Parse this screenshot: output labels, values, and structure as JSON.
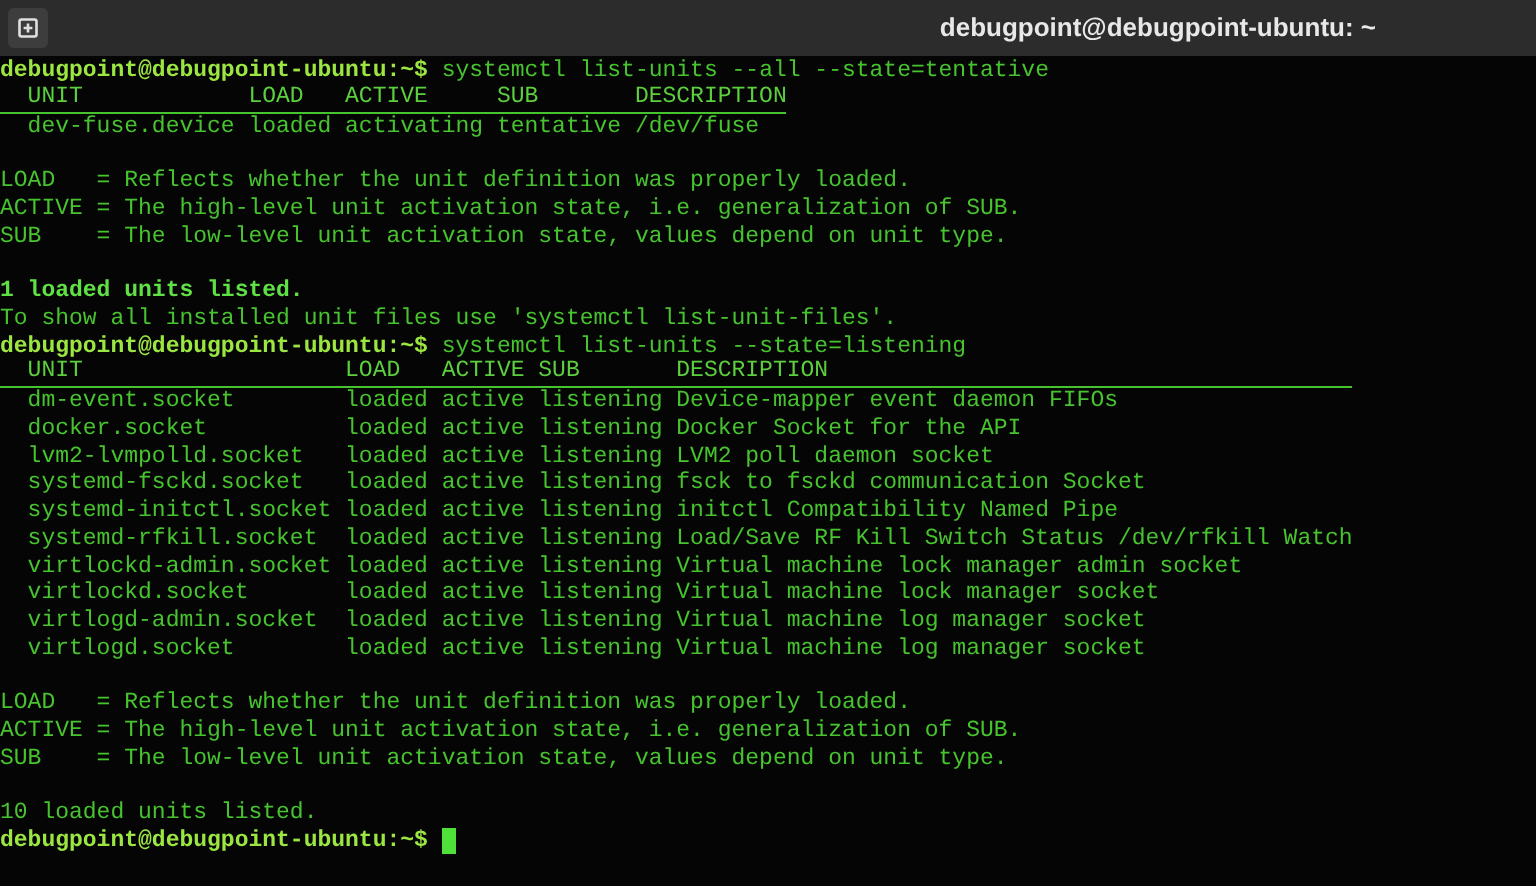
{
  "window": {
    "title": "debugpoint@debugpoint-ubuntu: ~"
  },
  "terminal": [
    {
      "kind": "prompt",
      "prompt": "debugpoint@debugpoint-ubuntu:~$",
      "command": "systemctl list-units --all --state=tentative",
      "cursor": false
    },
    {
      "kind": "table",
      "header": "  UNIT            LOAD   ACTIVE     SUB       DESCRIPTION",
      "rows": [
        "  dev-fuse.device loaded activating tentative /dev/fuse"
      ]
    },
    {
      "kind": "blank"
    },
    {
      "kind": "text",
      "text": "LOAD   = Reflects whether the unit definition was properly loaded."
    },
    {
      "kind": "text",
      "text": "ACTIVE = The high-level unit activation state, i.e. generalization of SUB."
    },
    {
      "kind": "text",
      "text": "SUB    = The low-level unit activation state, values depend on unit type."
    },
    {
      "kind": "blank"
    },
    {
      "kind": "bold",
      "text": "1 loaded units listed."
    },
    {
      "kind": "text",
      "text": "To show all installed unit files use 'systemctl list-unit-files'."
    },
    {
      "kind": "prompt",
      "prompt": "debugpoint@debugpoint-ubuntu:~$",
      "command": "systemctl list-units --state=listening",
      "cursor": false
    },
    {
      "kind": "table",
      "header": "  UNIT                   LOAD   ACTIVE SUB       DESCRIPTION",
      "rows": [
        "  dm-event.socket        loaded active listening Device-mapper event daemon FIFOs",
        "  docker.socket          loaded active listening Docker Socket for the API",
        "  lvm2-lvmpolld.socket   loaded active listening LVM2 poll daemon socket",
        "  systemd-fsckd.socket   loaded active listening fsck to fsckd communication Socket",
        "  systemd-initctl.socket loaded active listening initctl Compatibility Named Pipe",
        "  systemd-rfkill.socket  loaded active listening Load/Save RF Kill Switch Status /dev/rfkill Watch",
        "  virtlockd-admin.socket loaded active listening Virtual machine lock manager admin socket",
        "  virtlockd.socket       loaded active listening Virtual machine lock manager socket",
        "  virtlogd-admin.socket  loaded active listening Virtual machine log manager socket",
        "  virtlogd.socket        loaded active listening Virtual machine log manager socket"
      ]
    },
    {
      "kind": "blank"
    },
    {
      "kind": "text",
      "text": "LOAD   = Reflects whether the unit definition was properly loaded."
    },
    {
      "kind": "text",
      "text": "ACTIVE = The high-level unit activation state, i.e. generalization of SUB."
    },
    {
      "kind": "text",
      "text": "SUB    = The low-level unit activation state, values depend on unit type."
    },
    {
      "kind": "blank"
    },
    {
      "kind": "text",
      "text": "10 loaded units listed."
    },
    {
      "kind": "prompt",
      "prompt": "debugpoint@debugpoint-ubuntu:~$",
      "cursor": true
    }
  ]
}
